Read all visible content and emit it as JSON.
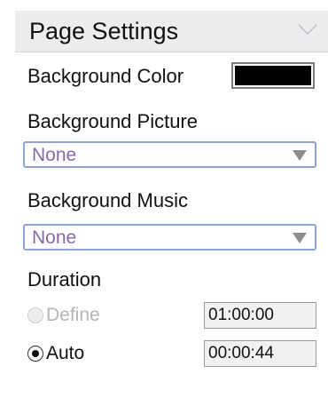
{
  "panel": {
    "title": "Page Settings"
  },
  "background_color": {
    "label": "Background Color",
    "value": "#000000"
  },
  "background_picture": {
    "label": "Background Picture",
    "selected": "None"
  },
  "background_music": {
    "label": "Background Music",
    "selected": "None"
  },
  "duration": {
    "label": "Duration",
    "define": {
      "label": "Define",
      "time": "01:00:00",
      "enabled": false,
      "selected": false
    },
    "auto": {
      "label": "Auto",
      "time": "00:00:44",
      "selected": true
    }
  }
}
